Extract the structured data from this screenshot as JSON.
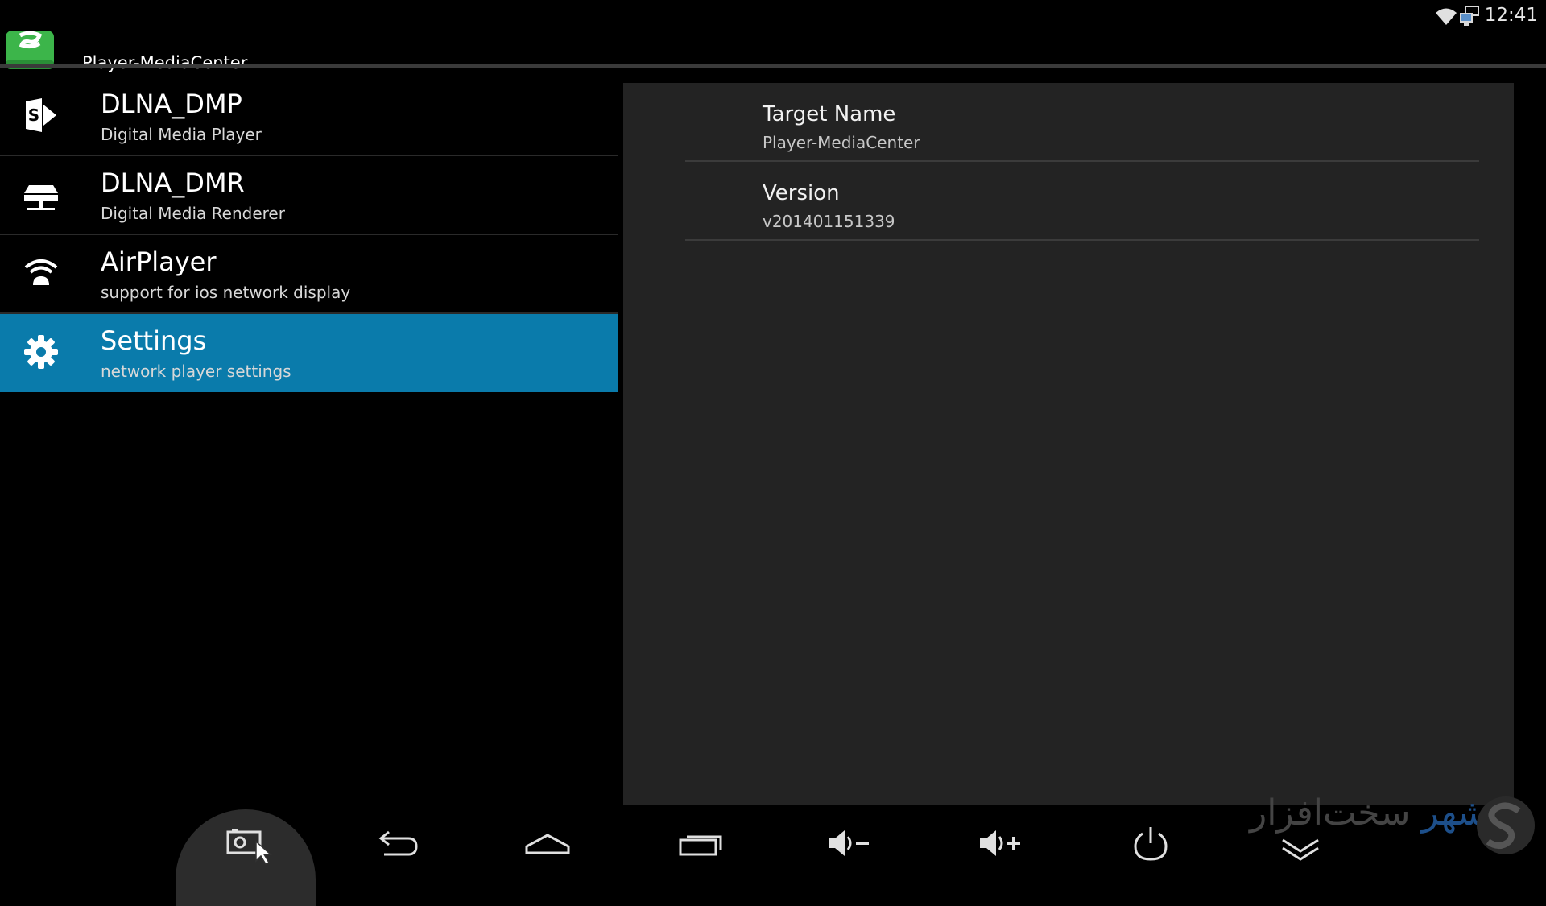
{
  "status_bar": {
    "time": "12:41",
    "icons": [
      "wifi-icon",
      "network-display-icon"
    ]
  },
  "action_bar": {
    "app_icon": "app-logo-icon",
    "title": "Player-MediaCenter"
  },
  "menu": {
    "items": [
      {
        "icon": "share-arrow-icon",
        "title": "DLNA_DMP",
        "subtitle": "Digital Media Player",
        "selected": false
      },
      {
        "icon": "server-icon",
        "title": "DLNA_DMR",
        "subtitle": "Digital Media Renderer",
        "selected": false
      },
      {
        "icon": "wifi-android-icon",
        "title": "AirPlayer",
        "subtitle": "support for ios network display",
        "selected": false
      },
      {
        "icon": "gear-icon",
        "title": "Settings",
        "subtitle": "network player settings",
        "selected": true
      }
    ]
  },
  "detail": {
    "rows": [
      {
        "title": "Target Name",
        "value": "Player-MediaCenter"
      },
      {
        "title": "Version",
        "value": "v201401151339"
      }
    ]
  },
  "nav_bar": {
    "buttons": [
      "screenshot-icon",
      "back-icon",
      "home-icon",
      "recent-apps-icon",
      "volume-down-icon",
      "volume-up-icon",
      "power-icon",
      "collapse-icon"
    ]
  },
  "watermark": {
    "text_a": "شهر",
    "text_b": "سخت‌افزار"
  },
  "colors": {
    "selected_bg": "#0a7bab",
    "panel_bg": "#232323",
    "app_icon_green": "#3cb54a"
  }
}
